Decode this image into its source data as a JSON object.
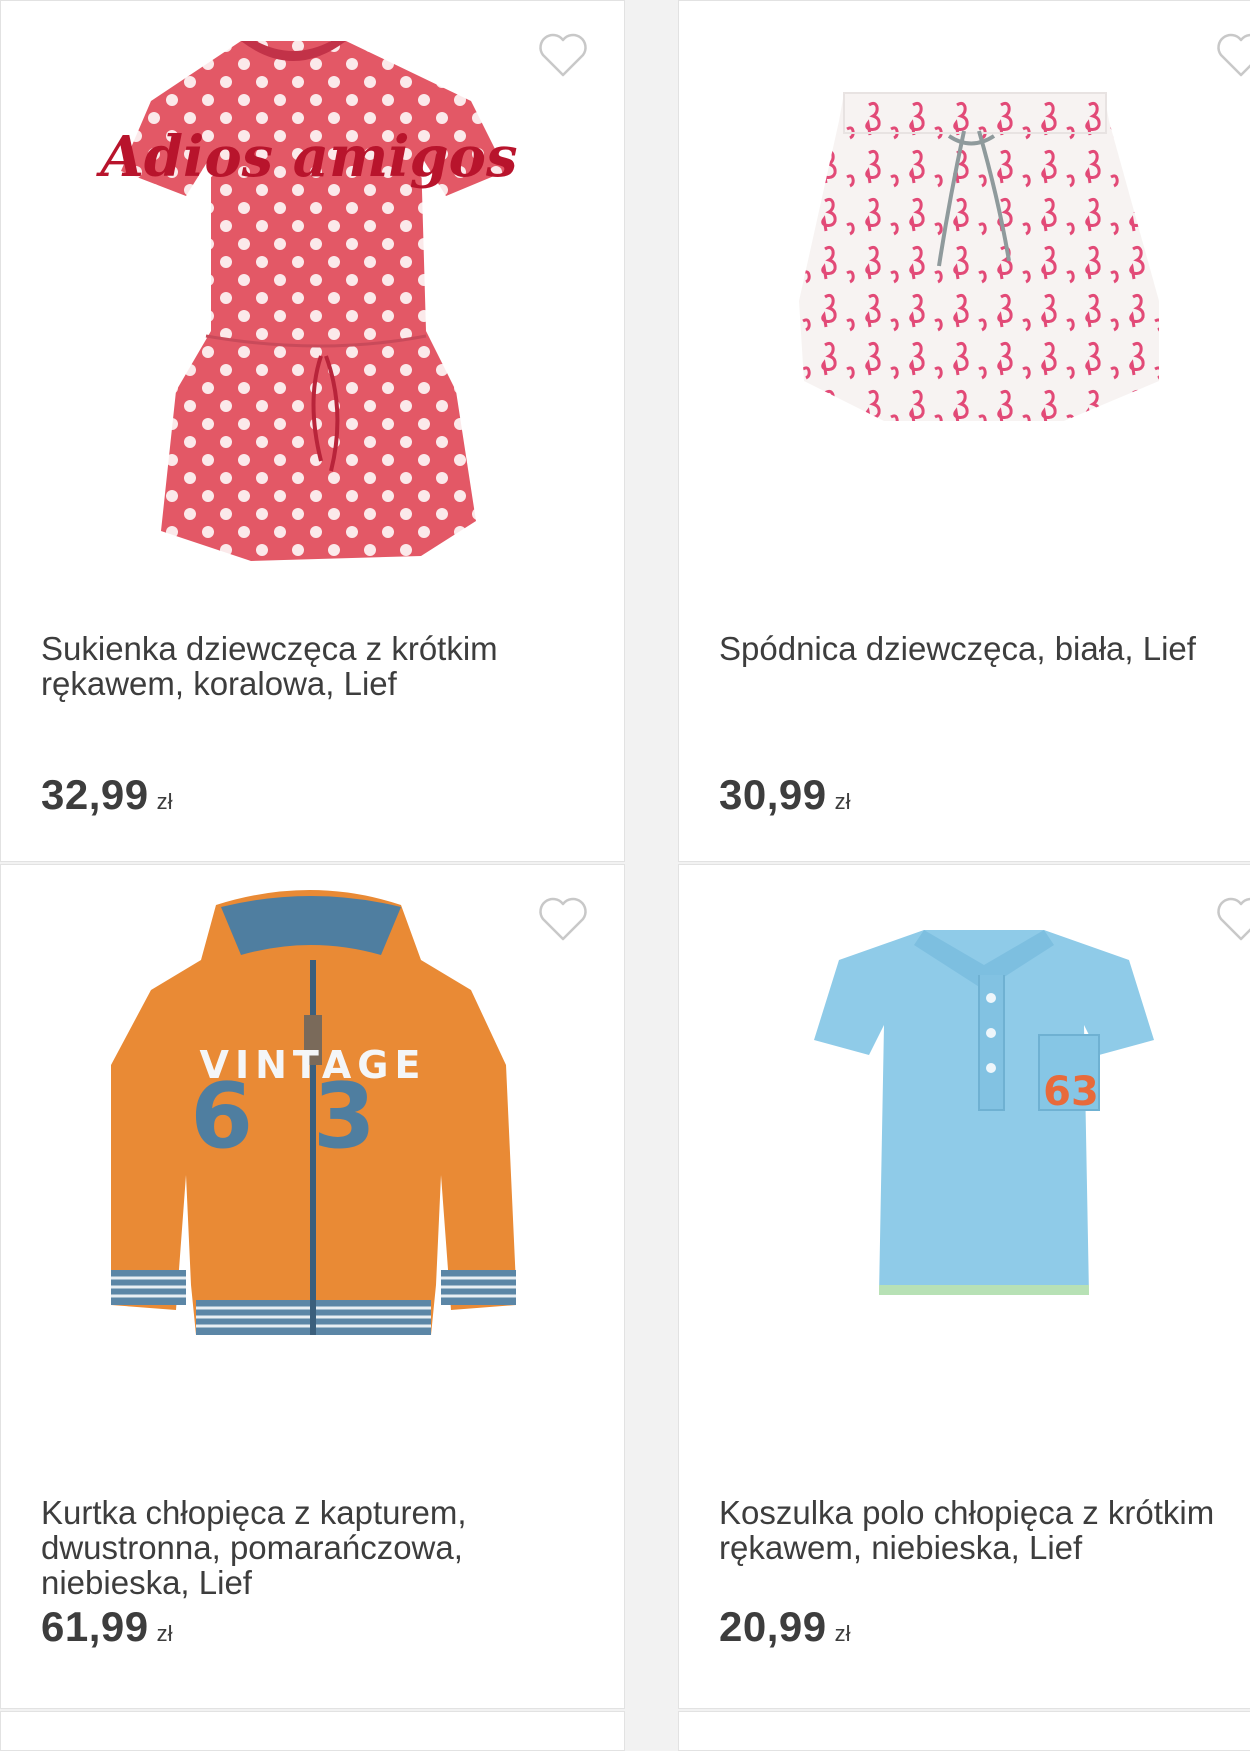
{
  "products": [
    {
      "title": "Sukienka dziewczęca z krótkim rękawem, koralowa, Lief",
      "price": "32,99",
      "currency": "zł",
      "image": "coral-polka-dot-dress",
      "text_on_dress": "Adios amigos"
    },
    {
      "title": "Spódnica dziewczęca, biała, Lief",
      "price": "30,99",
      "currency": "zł",
      "image": "white-flamingo-skirt"
    },
    {
      "title": "Kurtka chłopięca z kapturem, dwustronna, pomarańczowa, niebieska, Lief",
      "price": "61,99",
      "currency": "zł",
      "image": "orange-reversible-hoodie",
      "print_text": "VINTAGE",
      "print_number": "63"
    },
    {
      "title": "Koszulka polo chłopięca z krótkim rękawem, niebieska, Lief",
      "price": "20,99",
      "currency": "zł",
      "image": "light-blue-polo-shirt",
      "badge_number": "63"
    }
  ],
  "icons": {
    "favorite": "heart-outline-icon"
  },
  "colors": {
    "background": "#f2f2f2",
    "card": "#ffffff",
    "text": "#3d3d3d",
    "heart": "#c8c8c8"
  }
}
